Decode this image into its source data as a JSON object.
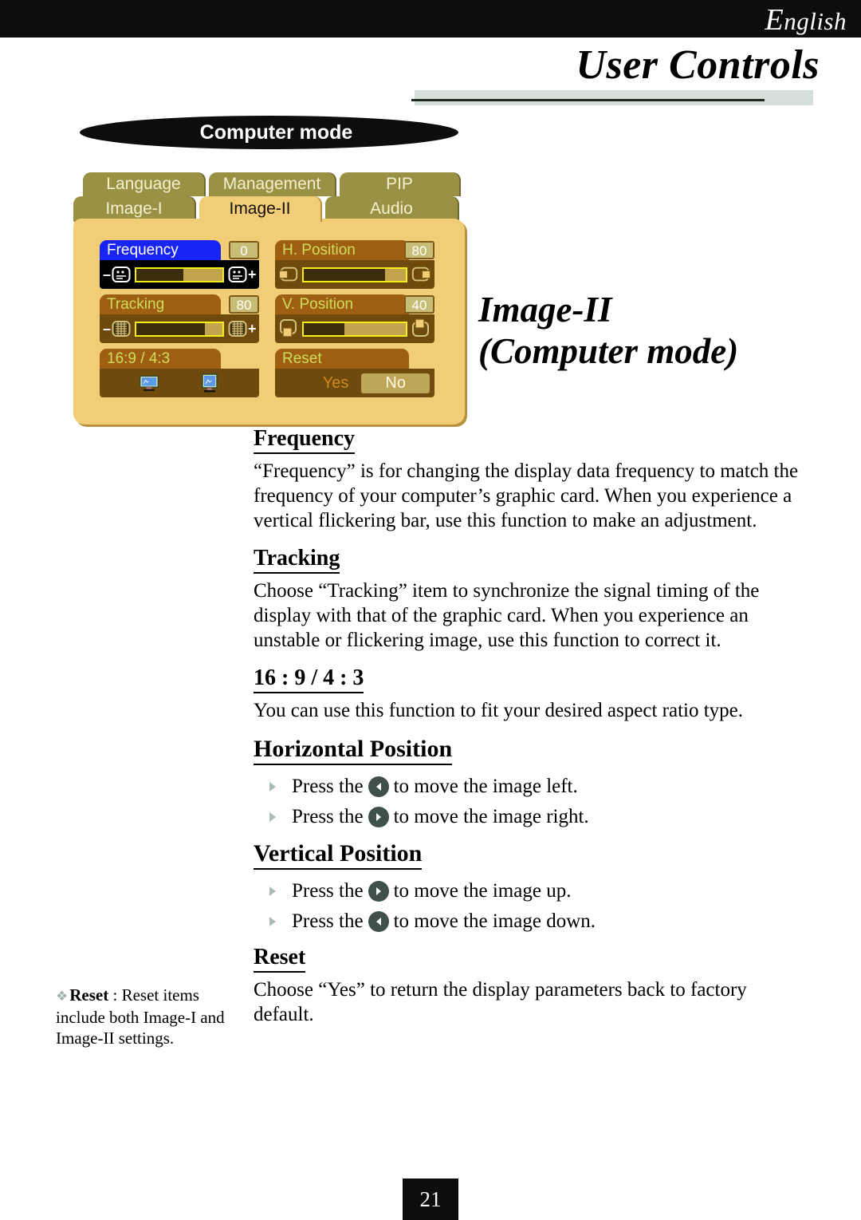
{
  "header": {
    "language": "English",
    "language_cap": "E",
    "language_rest": "nglish",
    "title": "User Controls",
    "section_pill": "Computer mode"
  },
  "osd": {
    "tabs": [
      {
        "label": "Language",
        "active": false
      },
      {
        "label": "Management",
        "active": false
      },
      {
        "label": "PIP",
        "active": false
      },
      {
        "label": "Image-I",
        "active": false
      },
      {
        "label": "Image-II",
        "active": true
      },
      {
        "label": "Audio",
        "active": false
      }
    ],
    "rows": [
      {
        "label": "Frequency",
        "value": "0",
        "fill_percent": 55,
        "selected": true,
        "icon": "frequency-icon"
      },
      {
        "label": "Tracking",
        "value": "80",
        "fill_percent": 80,
        "selected": false,
        "icon": "tracking-icon"
      },
      {
        "label": "16:9 / 4:3",
        "value": "",
        "selected": false,
        "icon": "aspect-ratio-icon"
      },
      {
        "label": "H. Position",
        "value": "80",
        "fill_percent": 80,
        "selected": false,
        "icon": "h-position-icon"
      },
      {
        "label": "V. Position",
        "value": "40",
        "fill_percent": 40,
        "selected": false,
        "icon": "v-position-icon"
      },
      {
        "label": "Reset",
        "value": "",
        "selected": false,
        "icon": "reset-icon"
      }
    ],
    "reset_options": {
      "yes": "Yes",
      "no": "No",
      "selected": "No"
    },
    "colors": {
      "panel": "#f2cd77",
      "tab": "#9a9145",
      "tab_active": "#f2cd77",
      "row_header": "#9f5f13",
      "row_header_selected": "#1823f5",
      "row_ctrl": "#6e4a0c",
      "row_ctrl_selected": "#000000",
      "slider_border": "#f2ee17",
      "slider_track": "#c2a44f",
      "slider_fill": "#3d2c09",
      "label_text": "#cddf5a"
    }
  },
  "main": {
    "title_line1": "Image-II",
    "title_line2": "(Computer mode)",
    "sections": [
      {
        "heading": "Frequency",
        "body": "“Frequency” is for changing the display data frequency to match the frequency of your computer’s graphic card. When you experience a vertical flickering bar, use this function to make an adjustment."
      },
      {
        "heading": "Tracking",
        "body": "Choose “Tracking” item to synchronize the signal timing of the display with that of the graphic card. When you experience an unstable or flickering image, use this function to correct it."
      },
      {
        "heading": "16 : 9 / 4 : 3",
        "body": "You can use this function to fit your desired aspect ratio type."
      },
      {
        "heading": "Horizontal Position",
        "bullets": [
          {
            "pre": "Press the",
            "arrow": "left",
            "post": "to move the image left."
          },
          {
            "pre": "Press the",
            "arrow": "right",
            "post": "to move the image right."
          }
        ]
      },
      {
        "heading": "Vertical Position",
        "bullets": [
          {
            "pre": "Press the",
            "arrow": "right",
            "post": "to move the image up."
          },
          {
            "pre": "Press the",
            "arrow": "left",
            "post": "to move the image down."
          }
        ]
      },
      {
        "heading": "Reset",
        "body": "Choose “Yes” to return the display parameters back to factory default."
      }
    ]
  },
  "footnote": {
    "mark": "❖",
    "label": "Reset",
    "separator": " : ",
    "text": "Reset items include both Image-I and Image-II settings."
  },
  "footer": {
    "page_number": "21"
  }
}
